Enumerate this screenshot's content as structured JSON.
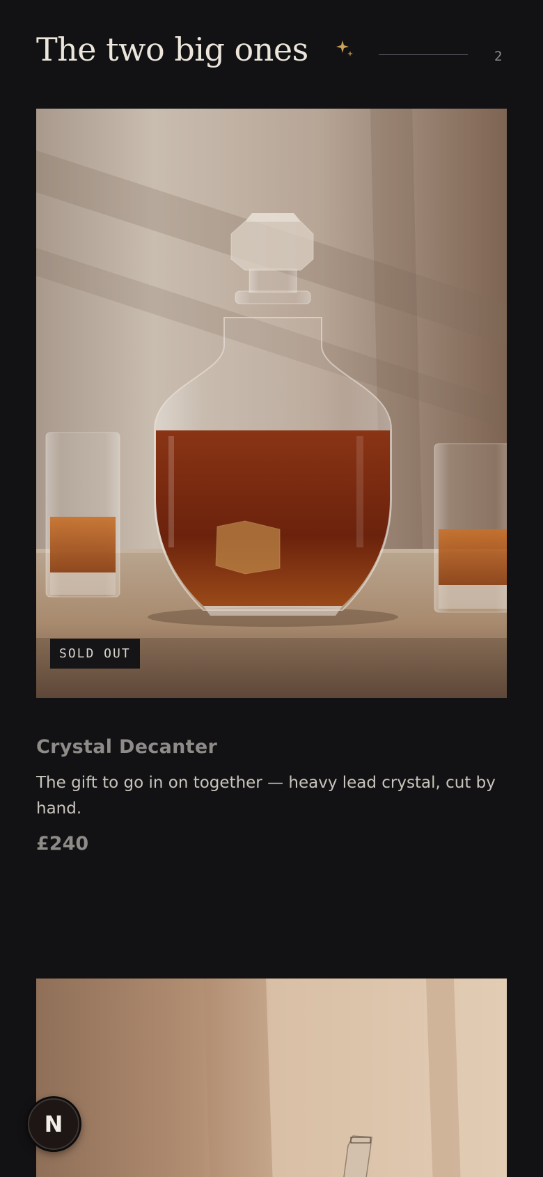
{
  "section": {
    "title": "The two big ones",
    "count": "2",
    "sparkle_icon": "sparkle-icon",
    "accent_color": "#c9a25b"
  },
  "products": [
    {
      "name": "Crystal Decanter",
      "description": "The gift to go in on together — heavy lead crystal, cut by hand.",
      "price": "£240",
      "badge": "SOLD OUT"
    }
  ],
  "fab": {
    "letter": "N"
  }
}
